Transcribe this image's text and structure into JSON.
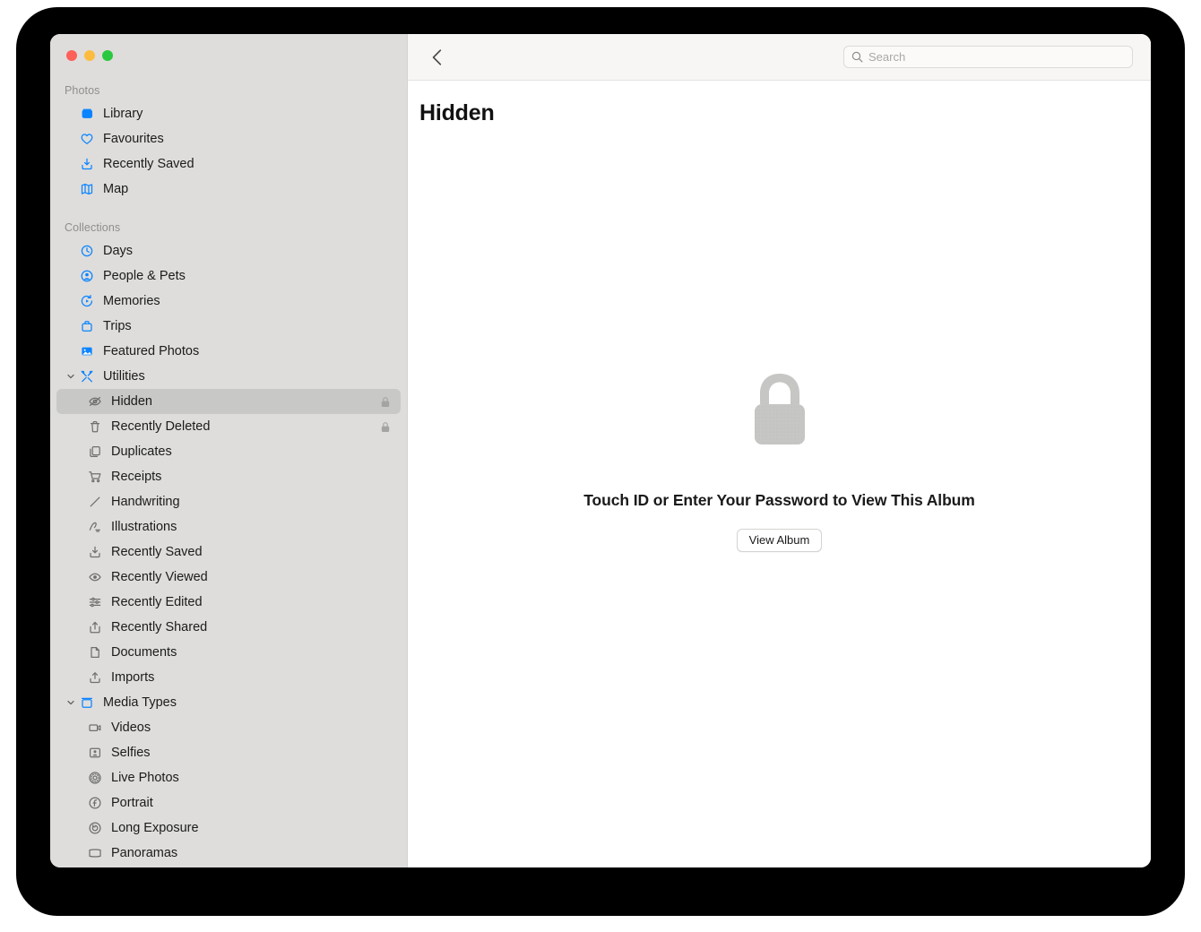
{
  "window": {
    "traffic_lights": [
      {
        "name": "close",
        "color": "#fc6058"
      },
      {
        "name": "minimize",
        "color": "#fdbc40"
      },
      {
        "name": "zoom",
        "color": "#2ac840"
      }
    ]
  },
  "toolbar": {
    "back_icon": "chevron-left-icon",
    "search": {
      "icon": "search-icon",
      "placeholder": "Search",
      "value": ""
    }
  },
  "main": {
    "title": "Hidden",
    "empty_state": {
      "icon": "lock-icon",
      "message": "Touch ID or Enter Your Password to View This Album",
      "button_label": "View Album"
    }
  },
  "sidebar": {
    "sections": [
      {
        "header": "Photos",
        "items": [
          {
            "label": "Library",
            "icon": "photo-library-icon",
            "tint": "blue",
            "indent": 0
          },
          {
            "label": "Favourites",
            "icon": "heart-icon",
            "tint": "blue",
            "indent": 0
          },
          {
            "label": "Recently Saved",
            "icon": "tray-arrow-down-icon",
            "tint": "blue",
            "indent": 0
          },
          {
            "label": "Map",
            "icon": "map-icon",
            "tint": "blue",
            "indent": 0
          }
        ]
      },
      {
        "header": "Collections",
        "items": [
          {
            "label": "Days",
            "icon": "clock-icon",
            "tint": "blue",
            "indent": 0
          },
          {
            "label": "People & Pets",
            "icon": "person-circle-icon",
            "tint": "blue",
            "indent": 0
          },
          {
            "label": "Memories",
            "icon": "memories-play-icon",
            "tint": "blue",
            "indent": 0
          },
          {
            "label": "Trips",
            "icon": "suitcase-icon",
            "tint": "blue",
            "indent": 0
          },
          {
            "label": "Featured Photos",
            "icon": "photo-frame-icon",
            "tint": "blue",
            "indent": 0
          },
          {
            "label": "Utilities",
            "icon": "tools-icon",
            "tint": "blue",
            "indent": 0,
            "disclosure": "expanded"
          },
          {
            "label": "Hidden",
            "icon": "eye-slash-icon",
            "tint": "gray",
            "indent": 1,
            "selected": true,
            "badge": "lock-icon"
          },
          {
            "label": "Recently Deleted",
            "icon": "trash-icon",
            "tint": "gray",
            "indent": 1,
            "badge": "lock-icon"
          },
          {
            "label": "Duplicates",
            "icon": "duplicate-icon",
            "tint": "gray",
            "indent": 1
          },
          {
            "label": "Receipts",
            "icon": "cart-icon",
            "tint": "gray",
            "indent": 1
          },
          {
            "label": "Handwriting",
            "icon": "pencil-line-icon",
            "tint": "gray",
            "indent": 1
          },
          {
            "label": "Illustrations",
            "icon": "scribble-icon",
            "tint": "gray",
            "indent": 1
          },
          {
            "label": "Recently Saved",
            "icon": "tray-arrow-down-icon",
            "tint": "gray",
            "indent": 1
          },
          {
            "label": "Recently Viewed",
            "icon": "eye-icon",
            "tint": "gray",
            "indent": 1
          },
          {
            "label": "Recently Edited",
            "icon": "sliders-icon",
            "tint": "gray",
            "indent": 1
          },
          {
            "label": "Recently Shared",
            "icon": "share-icon",
            "tint": "gray",
            "indent": 1
          },
          {
            "label": "Documents",
            "icon": "document-icon",
            "tint": "gray",
            "indent": 1
          },
          {
            "label": "Imports",
            "icon": "tray-arrow-up-icon",
            "tint": "gray",
            "indent": 1
          },
          {
            "label": "Media Types",
            "icon": "media-box-icon",
            "tint": "blue",
            "indent": 0,
            "disclosure": "expanded"
          },
          {
            "label": "Videos",
            "icon": "video-icon",
            "tint": "gray",
            "indent": 1
          },
          {
            "label": "Selfies",
            "icon": "selfie-icon",
            "tint": "gray",
            "indent": 1
          },
          {
            "label": "Live Photos",
            "icon": "live-photo-icon",
            "tint": "gray",
            "indent": 1
          },
          {
            "label": "Portrait",
            "icon": "portrait-icon",
            "tint": "gray",
            "indent": 1
          },
          {
            "label": "Long Exposure",
            "icon": "long-exposure-icon",
            "tint": "gray",
            "indent": 1
          },
          {
            "label": "Panoramas",
            "icon": "panorama-icon",
            "tint": "gray",
            "indent": 1
          }
        ]
      }
    ]
  },
  "colors": {
    "accent_blue": "#0a84ff",
    "sidebar_bg": "#dedddb",
    "selection_bg": "#c8c8c6",
    "toolbar_bg": "#f7f6f4",
    "icon_gray": "#6f6f6e",
    "lock_fill": "#c6c6c4"
  }
}
